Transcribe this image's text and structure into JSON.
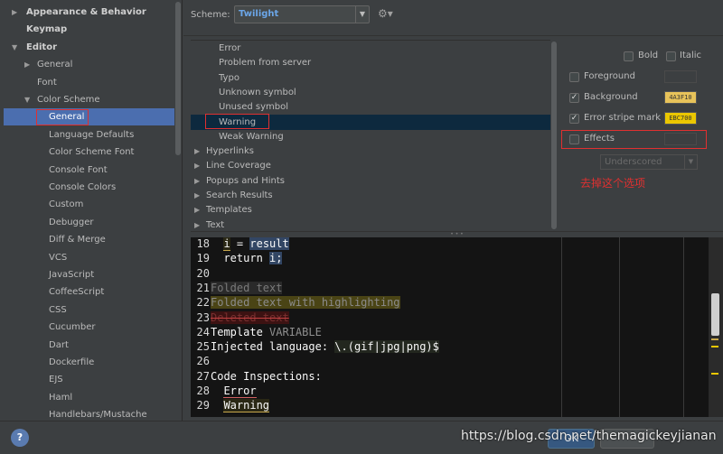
{
  "sidebar": {
    "items": [
      {
        "label": "Appearance & Behavior",
        "arrow": "▶",
        "level": 0,
        "bold": true
      },
      {
        "label": "Keymap",
        "arrow": "",
        "level": 0,
        "bold": true
      },
      {
        "label": "Editor",
        "arrow": "▼",
        "level": 0,
        "bold": true
      },
      {
        "label": "General",
        "arrow": "▶",
        "level": 1,
        "bold": false
      },
      {
        "label": "Font",
        "arrow": "",
        "level": 1,
        "bold": false
      },
      {
        "label": "Color Scheme",
        "arrow": "▼",
        "level": 1,
        "bold": false
      },
      {
        "label": "General",
        "arrow": "",
        "level": 2,
        "bold": false,
        "selected": true
      },
      {
        "label": "Language Defaults",
        "arrow": "",
        "level": 2,
        "bold": false
      },
      {
        "label": "Color Scheme Font",
        "arrow": "",
        "level": 2,
        "bold": false
      },
      {
        "label": "Console Font",
        "arrow": "",
        "level": 2,
        "bold": false
      },
      {
        "label": "Console Colors",
        "arrow": "",
        "level": 2,
        "bold": false
      },
      {
        "label": "Custom",
        "arrow": "",
        "level": 2,
        "bold": false
      },
      {
        "label": "Debugger",
        "arrow": "",
        "level": 2,
        "bold": false
      },
      {
        "label": "Diff & Merge",
        "arrow": "",
        "level": 2,
        "bold": false
      },
      {
        "label": "VCS",
        "arrow": "",
        "level": 2,
        "bold": false
      },
      {
        "label": "JavaScript",
        "arrow": "",
        "level": 2,
        "bold": false
      },
      {
        "label": "CoffeeScript",
        "arrow": "",
        "level": 2,
        "bold": false
      },
      {
        "label": "CSS",
        "arrow": "",
        "level": 2,
        "bold": false
      },
      {
        "label": "Cucumber",
        "arrow": "",
        "level": 2,
        "bold": false
      },
      {
        "label": "Dart",
        "arrow": "",
        "level": 2,
        "bold": false
      },
      {
        "label": "Dockerfile",
        "arrow": "",
        "level": 2,
        "bold": false
      },
      {
        "label": "EJS",
        "arrow": "",
        "level": 2,
        "bold": false
      },
      {
        "label": "Haml",
        "arrow": "",
        "level": 2,
        "bold": false
      },
      {
        "label": "Handlebars/Mustache",
        "arrow": "",
        "level": 2,
        "bold": false
      }
    ]
  },
  "scheme": {
    "label": "Scheme:",
    "value": "Twilight",
    "dropdown_icon": "chevron-down-icon",
    "gear_icon": "gear-icon"
  },
  "element_list": {
    "items": [
      {
        "label": "Error",
        "arrow": "",
        "level": 1
      },
      {
        "label": "Problem from server",
        "arrow": "",
        "level": 1
      },
      {
        "label": "Typo",
        "arrow": "",
        "level": 1
      },
      {
        "label": "Unknown symbol",
        "arrow": "",
        "level": 1
      },
      {
        "label": "Unused symbol",
        "arrow": "",
        "level": 1
      },
      {
        "label": "Warning",
        "arrow": "",
        "level": 1,
        "selected": true
      },
      {
        "label": "Weak Warning",
        "arrow": "",
        "level": 1
      },
      {
        "label": "Hyperlinks",
        "arrow": "▶",
        "level": 0
      },
      {
        "label": "Line Coverage",
        "arrow": "▶",
        "level": 0
      },
      {
        "label": "Popups and Hints",
        "arrow": "▶",
        "level": 0
      },
      {
        "label": "Search Results",
        "arrow": "▶",
        "level": 0
      },
      {
        "label": "Templates",
        "arrow": "▶",
        "level": 0
      },
      {
        "label": "Text",
        "arrow": "▶",
        "level": 0
      }
    ]
  },
  "attributes": {
    "bold_label": "Bold",
    "bold_checked": false,
    "italic_label": "Italic",
    "italic_checked": false,
    "foreground": {
      "label": "Foreground",
      "checked": false,
      "value": ""
    },
    "background": {
      "label": "Background",
      "checked": true,
      "value": "4A3F10",
      "color": "#e8c35a"
    },
    "error_stripe": {
      "label": "Error stripe mark",
      "checked": true,
      "value": "EBC700",
      "color": "#ebc700"
    },
    "effects": {
      "label": "Effects",
      "checked": false,
      "value": "",
      "style": "Underscored"
    },
    "check_glyph": "✓",
    "annotation": "去掉这个选项"
  },
  "code_preview": {
    "lines": [
      {
        "num": "18",
        "segments": [
          {
            "t": "  ",
            "c": ""
          },
          {
            "t": "i",
            "c": "tok-warning"
          },
          {
            "t": " = ",
            "c": ""
          },
          {
            "t": "result",
            "c": "hl-sel"
          }
        ]
      },
      {
        "num": "19",
        "segments": [
          {
            "t": "  return ",
            "c": ""
          },
          {
            "t": "i;",
            "c": "hl-sel"
          }
        ]
      },
      {
        "num": "20",
        "segments": [
          {
            "t": "",
            "c": ""
          }
        ]
      },
      {
        "num": "21",
        "segments": [
          {
            "t": "Folded text",
            "c": "tok-folded"
          }
        ]
      },
      {
        "num": "22",
        "segments": [
          {
            "t": "Folded text with highlighting",
            "c": "tok-foldhl"
          }
        ]
      },
      {
        "num": "23",
        "segments": [
          {
            "t": "Deleted text",
            "c": "tok-deleted"
          }
        ]
      },
      {
        "num": "24",
        "segments": [
          {
            "t": "Template ",
            "c": ""
          },
          {
            "t": "VARIABLE",
            "c": "tok-template"
          }
        ]
      },
      {
        "num": "25",
        "segments": [
          {
            "t": "Injected language: ",
            "c": ""
          },
          {
            "t": "\\.(gif|jpg|png)$",
            "c": "tok-injected"
          }
        ]
      },
      {
        "num": "26",
        "segments": [
          {
            "t": "",
            "c": ""
          }
        ]
      },
      {
        "num": "27",
        "segments": [
          {
            "t": "Code Inspections:",
            "c": ""
          }
        ]
      },
      {
        "num": "28",
        "segments": [
          {
            "t": "  ",
            "c": ""
          },
          {
            "t": "Error",
            "c": "tok-error"
          }
        ]
      },
      {
        "num": "29",
        "segments": [
          {
            "t": "  ",
            "c": ""
          },
          {
            "t": "Warning",
            "c": "tok-warning"
          }
        ]
      }
    ]
  },
  "bottom": {
    "help_label": "?",
    "ok_label": "OK",
    "watermark": "https://blog.csdn.net/themagickeyjianan"
  }
}
